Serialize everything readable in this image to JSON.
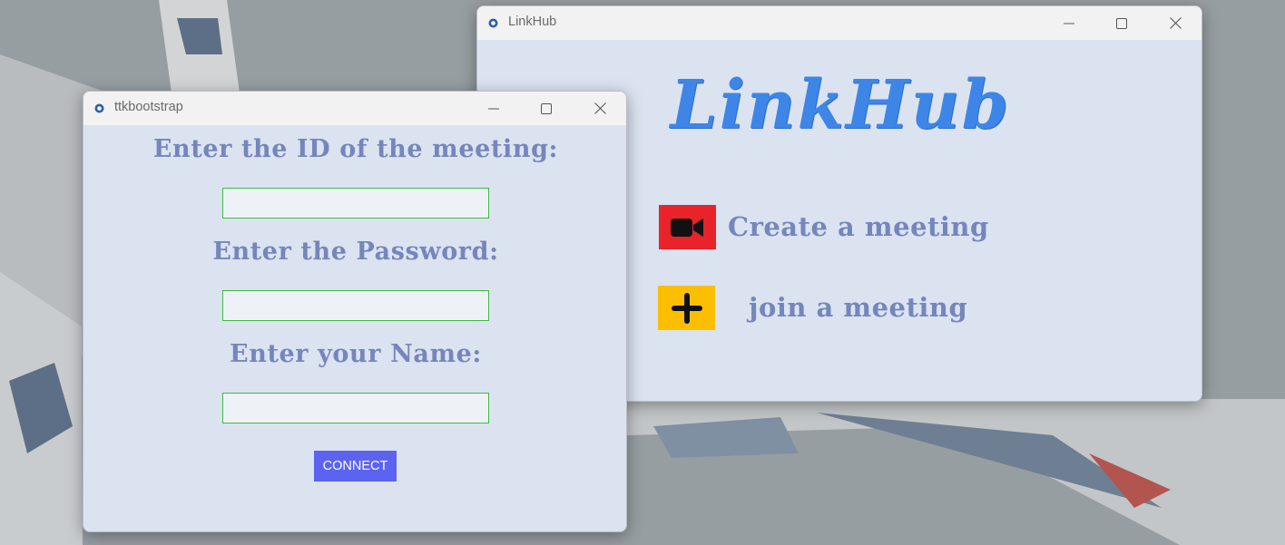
{
  "linkhub_window": {
    "title": "LinkHub",
    "logo_text": "LinkHub",
    "logo_color": "#3d86e8",
    "create_meeting_label": "Create a meeting",
    "join_meeting_label": "join a meeting",
    "create_icon": "video-camera-icon",
    "create_icon_bg": "#e8232a",
    "join_icon": "plus-icon",
    "join_icon_bg": "#fbbf00"
  },
  "ttk_window": {
    "title": "ttkbootstrap",
    "meeting_id_prompt": "Enter the ID of the meeting:",
    "meeting_id_value": "",
    "password_prompt": "Enter the Password:",
    "password_value": "",
    "name_prompt": "Enter your Name:",
    "name_value": "",
    "connect_label": "CONNECT",
    "accent_color": "#5b63f0"
  },
  "colors": {
    "window_bg": "#dbe3f1",
    "label_color": "#7586bb",
    "entry_border": "#3fba3f"
  }
}
